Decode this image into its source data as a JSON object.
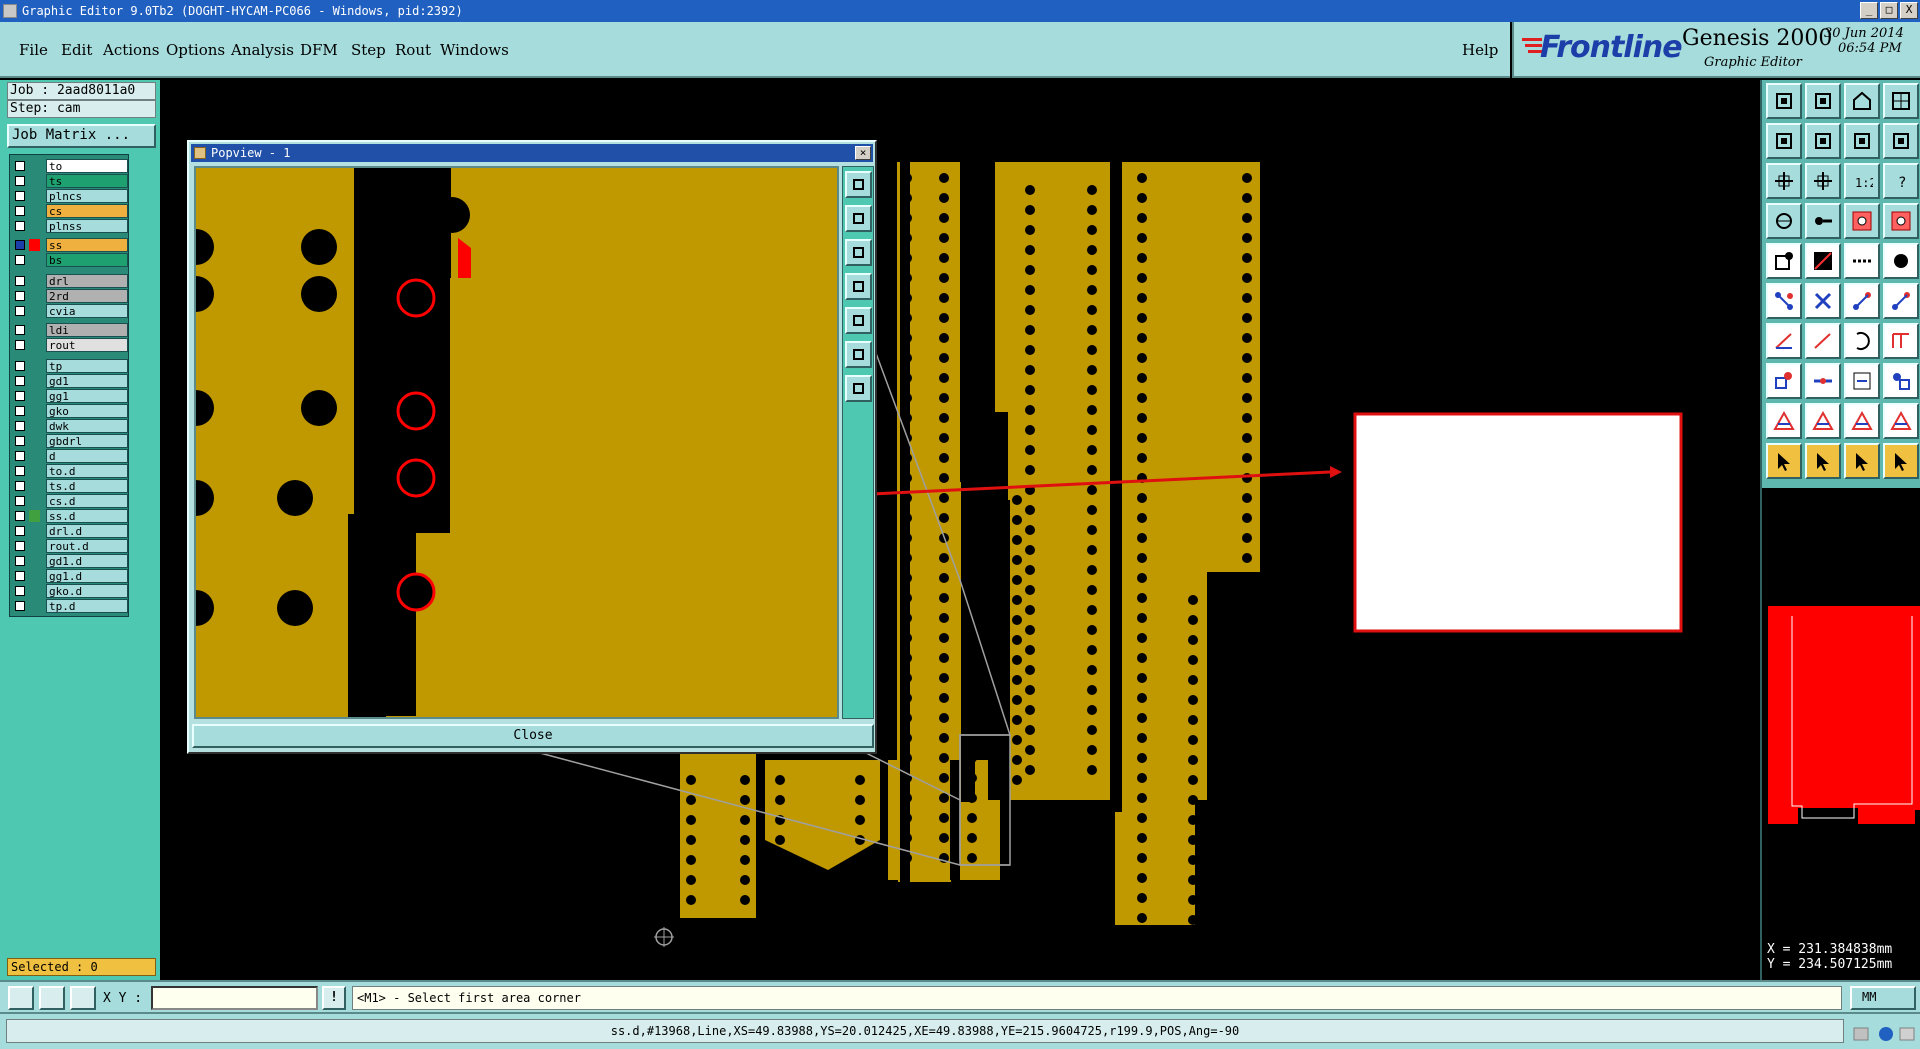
{
  "window": {
    "title": "Graphic Editor 9.0Tb2 (DOGHT-HYCAM-PC066 - Windows, pid:2392)",
    "buttons": [
      "_",
      "□",
      "X"
    ]
  },
  "menubar": {
    "items": [
      "File",
      "Edit",
      "Actions",
      "Options",
      "Analysis",
      "DFM",
      "Step",
      "Rout",
      "Windows"
    ],
    "help": "Help"
  },
  "brand": {
    "logo": "Frontline",
    "product": "Genesis 2000",
    "subtitle": "Graphic Editor",
    "date": "30 Jun 2014",
    "time": "06:54 PM"
  },
  "job": {
    "job_label": "Job : 2aad8011a0",
    "step_label": "Step: cam",
    "matrix_button": "Job Matrix ..."
  },
  "layers": [
    {
      "name": "to",
      "color": "#ffffff",
      "swatch": ""
    },
    {
      "name": "ts",
      "color": "#1fa070",
      "swatch": ""
    },
    {
      "name": "plncs",
      "color": "#a6dcdc",
      "swatch": ""
    },
    {
      "name": "cs",
      "color": "#f0b040",
      "swatch": ""
    },
    {
      "name": "plnss",
      "color": "#a6dcdc",
      "swatch": ""
    },
    {
      "name": "ss",
      "color": "#f0b040",
      "swatch": "#ff0000",
      "work": true
    },
    {
      "name": "bs",
      "color": "#1fa070",
      "swatch": ""
    },
    {
      "name": "drl",
      "color": "#b0b0b0",
      "swatch": ""
    },
    {
      "name": "2rd",
      "color": "#b0b0b0",
      "swatch": ""
    },
    {
      "name": "cvia",
      "color": "#a6dcdc",
      "swatch": ""
    },
    {
      "name": "ldi",
      "color": "#b0b0b0",
      "swatch": ""
    },
    {
      "name": "rout",
      "color": "#e0e0e0",
      "swatch": ""
    },
    {
      "name": "tp",
      "color": "#a6dcdc",
      "swatch": ""
    },
    {
      "name": "gd1",
      "color": "#a6dcdc",
      "swatch": ""
    },
    {
      "name": "gg1",
      "color": "#a6dcdc",
      "swatch": ""
    },
    {
      "name": "gko",
      "color": "#a6dcdc",
      "swatch": ""
    },
    {
      "name": "dwk",
      "color": "#a6dcdc",
      "swatch": ""
    },
    {
      "name": "gbdrl",
      "color": "#a6dcdc",
      "swatch": ""
    },
    {
      "name": "d",
      "color": "#a6dcdc",
      "swatch": ""
    },
    {
      "name": "to.d",
      "color": "#a6dcdc",
      "swatch": ""
    },
    {
      "name": "ts.d",
      "color": "#a6dcdc",
      "swatch": ""
    },
    {
      "name": "cs.d",
      "color": "#a6dcdc",
      "swatch": ""
    },
    {
      "name": "ss.d",
      "color": "#a6dcdc",
      "swatch": "#40a040"
    },
    {
      "name": "drl.d",
      "color": "#a6dcdc",
      "swatch": ""
    },
    {
      "name": "rout.d",
      "color": "#a6dcdc",
      "swatch": ""
    },
    {
      "name": "gd1.d",
      "color": "#a6dcdc",
      "swatch": ""
    },
    {
      "name": "gg1.d",
      "color": "#a6dcdc",
      "swatch": ""
    },
    {
      "name": "gko.d",
      "color": "#a6dcdc",
      "swatch": ""
    },
    {
      "name": "tp.d",
      "color": "#a6dcdc",
      "swatch": ""
    }
  ],
  "selected_label": "Selected : 0",
  "popview": {
    "title": "Popview - 1",
    "close_button": "Close"
  },
  "toolbox": {
    "icons": [
      "zoom-home-icon",
      "zoom-step-icon",
      "home-icon",
      "layout-icon",
      "pan-left-icon",
      "pan-right-icon",
      "zoom-out-icon",
      "zoom-in-icon",
      "fit-icon",
      "center-icon",
      "ratio-icon",
      "help-icon",
      "snap-icon",
      "measure-icon",
      "route-icon",
      "mirror-icon",
      "select-pad-icon",
      "draw-icon",
      "dash-icon",
      "circle-icon",
      "node-icon",
      "cross-icon",
      "link-icon",
      "connect-icon",
      "angle-icon",
      "line-icon",
      "arc-icon",
      "fork-icon",
      "vertex-icon",
      "minus-icon",
      "resize-icon",
      "group-icon",
      "triangle-icon",
      "triangle-a-icon",
      "triangle-b-icon",
      "triangle-c-icon",
      "pointer-icon",
      "pointer-sel-icon",
      "pointer-edit-icon",
      "pointer-multi-icon"
    ],
    "ratio_label": "1:2",
    "help_label": "?"
  },
  "coords": {
    "x": "X = 231.384838mm",
    "y": "Y = 234.507125mm"
  },
  "command": {
    "xy_label": "X Y :",
    "xy_value": "",
    "bang": "!",
    "prompt": "<M1> - Select first area corner",
    "unit": "MM"
  },
  "status": {
    "text": "ss.d,#13968,Line,XS=49.83988,YS=20.012425,XE=49.83988,YE=215.9604725,r199.9,POS,Ang=-90"
  },
  "colors": {
    "copper": "#c09800",
    "highlight": "#ff0000",
    "panel": "#a6dcdc"
  }
}
